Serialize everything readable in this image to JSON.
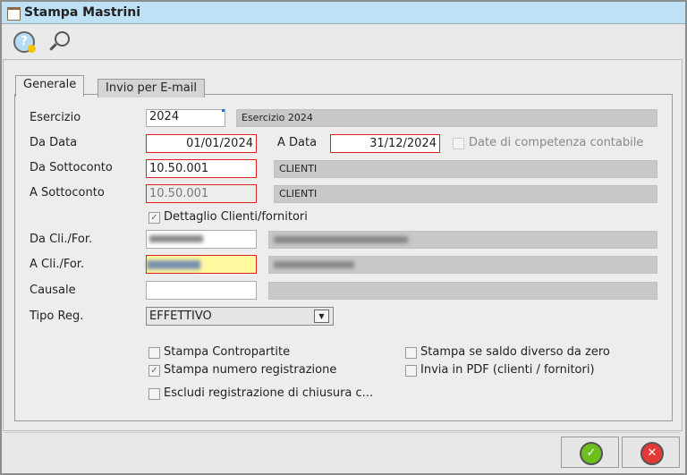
{
  "window": {
    "title": "Stampa Mastrini"
  },
  "toolbar": {
    "help_icon": "help-icon",
    "search_icon": "search-icon"
  },
  "tabs": [
    {
      "label": "Generale",
      "active": true
    },
    {
      "label": "Invio per E-mail",
      "active": false
    }
  ],
  "form": {
    "esercizio": {
      "label": "Esercizio",
      "value": "2024",
      "desc": "Esercizio 2024"
    },
    "da_data": {
      "label": "Da Data",
      "value": "01/01/2024"
    },
    "a_data": {
      "label": "A Data",
      "value": "31/12/2024"
    },
    "date_competenza": {
      "label": "Date di competenza contabile",
      "checked": false,
      "enabled": false
    },
    "da_sottoconto": {
      "label": "Da Sottoconto",
      "value": "10.50.001",
      "desc": "CLIENTI"
    },
    "a_sottoconto": {
      "label": "A Sottoconto",
      "value": "10.50.001",
      "desc": "CLIENTI"
    },
    "dettaglio": {
      "label": "Dettaglio Clienti/fornitori",
      "checked": true
    },
    "da_cli": {
      "label": "Da Cli./For."
    },
    "a_cli": {
      "label": "A Cli./For."
    },
    "causale": {
      "label": "Causale",
      "value": ""
    },
    "tipo_reg": {
      "label": "Tipo Reg.",
      "value": "EFFETTIVO"
    },
    "options": [
      {
        "label": "Stampa Contropartite",
        "checked": false
      },
      {
        "label": "Stampa numero registrazione",
        "checked": true
      },
      {
        "label": "Escludi registrazione di chiusura c...",
        "checked": false
      },
      {
        "label": "Stampa se saldo diverso da zero",
        "checked": false
      },
      {
        "label": "Invia in PDF (clienti / fornitori)",
        "checked": false
      }
    ]
  },
  "colors": {
    "title_bar": "#bfe1f6",
    "required_border": "#dd2222",
    "focus_field": "#fff9a0",
    "ok": "#6cbf1c",
    "cancel": "#e53935"
  }
}
